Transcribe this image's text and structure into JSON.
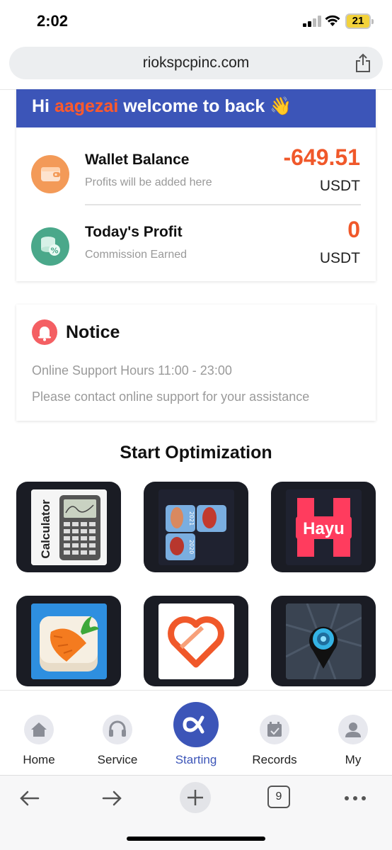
{
  "status_bar": {
    "time": "2:02",
    "battery": "21"
  },
  "browser": {
    "url": "riokspcpinc.com",
    "tab_count": "9"
  },
  "welcome": {
    "greeting_prefix": "Hi",
    "username": "aagezai",
    "greeting_suffix": "welcome to back",
    "emoji": "👋"
  },
  "wallet": {
    "title": "Wallet Balance",
    "subtitle": "Profits will be added here",
    "value": "-649.51",
    "unit": "USDT",
    "icon": "wallet-icon"
  },
  "profit": {
    "title": "Today's Profit",
    "subtitle": "Commission Earned",
    "value": "0",
    "unit": "USDT",
    "icon": "coins-percent-icon"
  },
  "notice": {
    "title": "Notice",
    "line1": "Online Support Hours 11:00 - 23:00",
    "line2": "Please contact online support for your assistance"
  },
  "optimization": {
    "title": "Start Optimization",
    "apps": [
      {
        "name": "calculator-app",
        "art_text": "Calculator"
      },
      {
        "name": "anatomy-app",
        "art_years": [
          "2021",
          "2020"
        ]
      },
      {
        "name": "hayu-app",
        "art_text": "Hayu"
      },
      {
        "name": "carrot-game-app"
      },
      {
        "name": "heart-app"
      },
      {
        "name": "location-app"
      }
    ]
  },
  "tabs": [
    {
      "label": "Home",
      "icon": "home-icon"
    },
    {
      "label": "Service",
      "icon": "headset-icon"
    },
    {
      "label": "Starting",
      "icon": "alpha-logo-icon",
      "active": true
    },
    {
      "label": "Records",
      "icon": "calendar-icon"
    },
    {
      "label": "My",
      "icon": "user-icon"
    }
  ],
  "colors": {
    "brand_blue": "#3c55b8",
    "accent_orange": "#f0582a",
    "notice_red": "#f45f63"
  }
}
